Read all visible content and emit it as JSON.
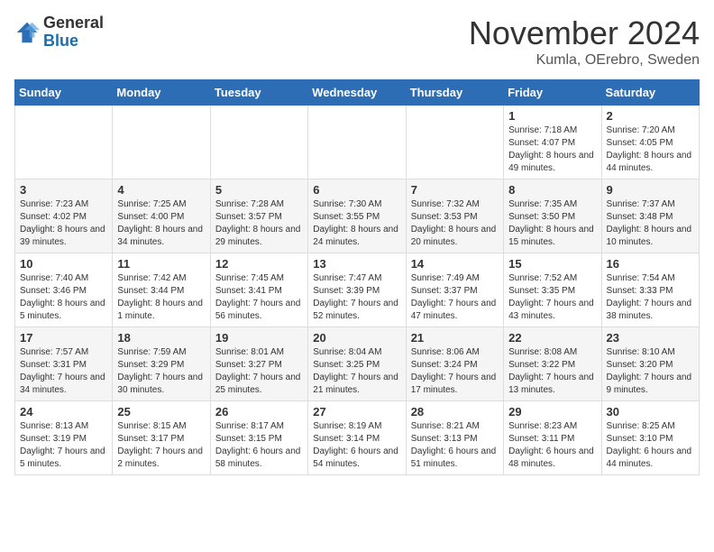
{
  "header": {
    "logo_general": "General",
    "logo_blue": "Blue",
    "month_title": "November 2024",
    "location": "Kumla, OErebro, Sweden"
  },
  "days_of_week": [
    "Sunday",
    "Monday",
    "Tuesday",
    "Wednesday",
    "Thursday",
    "Friday",
    "Saturday"
  ],
  "weeks": [
    [
      {
        "day": "",
        "info": ""
      },
      {
        "day": "",
        "info": ""
      },
      {
        "day": "",
        "info": ""
      },
      {
        "day": "",
        "info": ""
      },
      {
        "day": "",
        "info": ""
      },
      {
        "day": "1",
        "info": "Sunrise: 7:18 AM\nSunset: 4:07 PM\nDaylight: 8 hours and 49 minutes."
      },
      {
        "day": "2",
        "info": "Sunrise: 7:20 AM\nSunset: 4:05 PM\nDaylight: 8 hours and 44 minutes."
      }
    ],
    [
      {
        "day": "3",
        "info": "Sunrise: 7:23 AM\nSunset: 4:02 PM\nDaylight: 8 hours and 39 minutes."
      },
      {
        "day": "4",
        "info": "Sunrise: 7:25 AM\nSunset: 4:00 PM\nDaylight: 8 hours and 34 minutes."
      },
      {
        "day": "5",
        "info": "Sunrise: 7:28 AM\nSunset: 3:57 PM\nDaylight: 8 hours and 29 minutes."
      },
      {
        "day": "6",
        "info": "Sunrise: 7:30 AM\nSunset: 3:55 PM\nDaylight: 8 hours and 24 minutes."
      },
      {
        "day": "7",
        "info": "Sunrise: 7:32 AM\nSunset: 3:53 PM\nDaylight: 8 hours and 20 minutes."
      },
      {
        "day": "8",
        "info": "Sunrise: 7:35 AM\nSunset: 3:50 PM\nDaylight: 8 hours and 15 minutes."
      },
      {
        "day": "9",
        "info": "Sunrise: 7:37 AM\nSunset: 3:48 PM\nDaylight: 8 hours and 10 minutes."
      }
    ],
    [
      {
        "day": "10",
        "info": "Sunrise: 7:40 AM\nSunset: 3:46 PM\nDaylight: 8 hours and 5 minutes."
      },
      {
        "day": "11",
        "info": "Sunrise: 7:42 AM\nSunset: 3:44 PM\nDaylight: 8 hours and 1 minute."
      },
      {
        "day": "12",
        "info": "Sunrise: 7:45 AM\nSunset: 3:41 PM\nDaylight: 7 hours and 56 minutes."
      },
      {
        "day": "13",
        "info": "Sunrise: 7:47 AM\nSunset: 3:39 PM\nDaylight: 7 hours and 52 minutes."
      },
      {
        "day": "14",
        "info": "Sunrise: 7:49 AM\nSunset: 3:37 PM\nDaylight: 7 hours and 47 minutes."
      },
      {
        "day": "15",
        "info": "Sunrise: 7:52 AM\nSunset: 3:35 PM\nDaylight: 7 hours and 43 minutes."
      },
      {
        "day": "16",
        "info": "Sunrise: 7:54 AM\nSunset: 3:33 PM\nDaylight: 7 hours and 38 minutes."
      }
    ],
    [
      {
        "day": "17",
        "info": "Sunrise: 7:57 AM\nSunset: 3:31 PM\nDaylight: 7 hours and 34 minutes."
      },
      {
        "day": "18",
        "info": "Sunrise: 7:59 AM\nSunset: 3:29 PM\nDaylight: 7 hours and 30 minutes."
      },
      {
        "day": "19",
        "info": "Sunrise: 8:01 AM\nSunset: 3:27 PM\nDaylight: 7 hours and 25 minutes."
      },
      {
        "day": "20",
        "info": "Sunrise: 8:04 AM\nSunset: 3:25 PM\nDaylight: 7 hours and 21 minutes."
      },
      {
        "day": "21",
        "info": "Sunrise: 8:06 AM\nSunset: 3:24 PM\nDaylight: 7 hours and 17 minutes."
      },
      {
        "day": "22",
        "info": "Sunrise: 8:08 AM\nSunset: 3:22 PM\nDaylight: 7 hours and 13 minutes."
      },
      {
        "day": "23",
        "info": "Sunrise: 8:10 AM\nSunset: 3:20 PM\nDaylight: 7 hours and 9 minutes."
      }
    ],
    [
      {
        "day": "24",
        "info": "Sunrise: 8:13 AM\nSunset: 3:19 PM\nDaylight: 7 hours and 5 minutes."
      },
      {
        "day": "25",
        "info": "Sunrise: 8:15 AM\nSunset: 3:17 PM\nDaylight: 7 hours and 2 minutes."
      },
      {
        "day": "26",
        "info": "Sunrise: 8:17 AM\nSunset: 3:15 PM\nDaylight: 6 hours and 58 minutes."
      },
      {
        "day": "27",
        "info": "Sunrise: 8:19 AM\nSunset: 3:14 PM\nDaylight: 6 hours and 54 minutes."
      },
      {
        "day": "28",
        "info": "Sunrise: 8:21 AM\nSunset: 3:13 PM\nDaylight: 6 hours and 51 minutes."
      },
      {
        "day": "29",
        "info": "Sunrise: 8:23 AM\nSunset: 3:11 PM\nDaylight: 6 hours and 48 minutes."
      },
      {
        "day": "30",
        "info": "Sunrise: 8:25 AM\nSunset: 3:10 PM\nDaylight: 6 hours and 44 minutes."
      }
    ]
  ]
}
